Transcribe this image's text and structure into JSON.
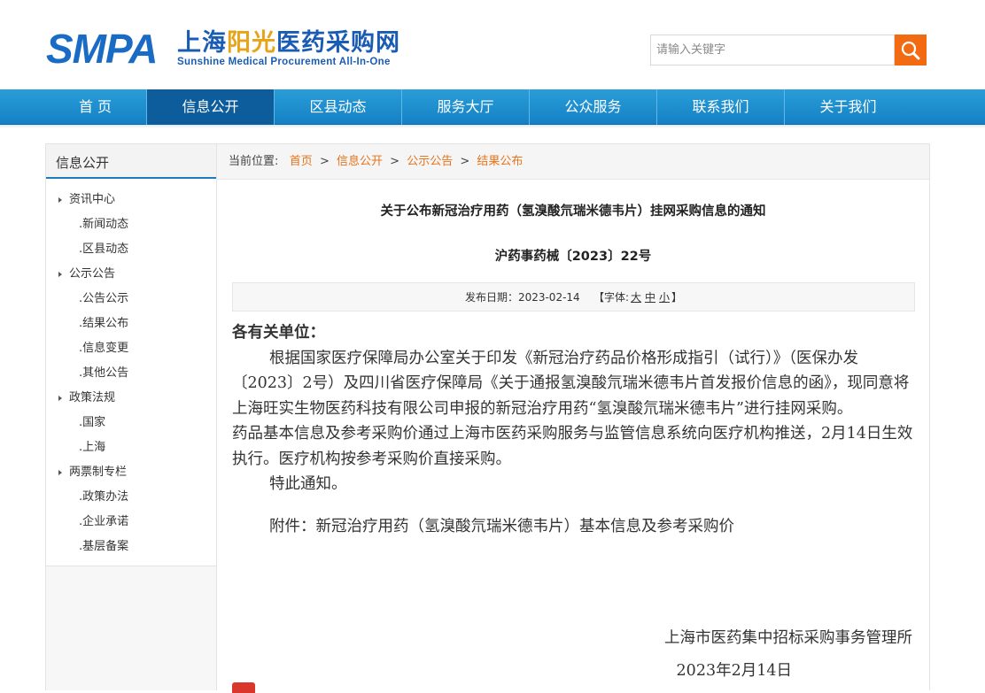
{
  "header": {
    "logo_abbr": "SMPA",
    "logo_cn_1": "上海",
    "logo_cn_2": "阳光",
    "logo_cn_3": "医药采购网",
    "logo_en": "Sunshine Medical Procurement All-In-One",
    "search_placeholder": "请输入关键字"
  },
  "nav": {
    "items": [
      {
        "label": "首 页"
      },
      {
        "label": "信息公开"
      },
      {
        "label": "区县动态"
      },
      {
        "label": "服务大厅"
      },
      {
        "label": "公众服务"
      },
      {
        "label": "联系我们"
      },
      {
        "label": "关于我们"
      }
    ],
    "active_index": 1
  },
  "sidebar": {
    "title": "信息公开",
    "items": [
      {
        "label": "资讯中心"
      },
      {
        "label": ".新闻动态"
      },
      {
        "label": ".区县动态"
      },
      {
        "label": "公示公告"
      },
      {
        "label": ".公告公示"
      },
      {
        "label": ".结果公布"
      },
      {
        "label": ".信息变更"
      },
      {
        "label": ".其他公告"
      },
      {
        "label": "政策法规"
      },
      {
        "label": ".国家"
      },
      {
        "label": ".上海"
      },
      {
        "label": "两票制专栏"
      },
      {
        "label": ".政策办法"
      },
      {
        "label": ".企业承诺"
      },
      {
        "label": ".基层备案"
      }
    ]
  },
  "breadcrumb": {
    "prefix": "当前位置:",
    "items": [
      "首页",
      "信息公开",
      "公示公告",
      "结果公布"
    ],
    "separator": ">"
  },
  "article": {
    "title": "关于公布新冠治疗用药（氢溴酸氘瑞米德韦片）挂网采购信息的通知",
    "doc_number": "沪药事药械〔2023〕22号",
    "publish_label": "发布日期：2023-02-14",
    "font_size_label": "【字体:",
    "font_large": "大",
    "font_medium": "中",
    "font_small": "小",
    "font_close": "】",
    "salutation": "各有关单位：",
    "para1": "根据国家医疗保障局办公室关于印发《新冠治疗药品价格形成指引（试行）》（医保办发〔2023〕2号）及四川省医疗保障局《关于通报氢溴酸氘瑞米德韦片首发报价信息的函》，现同意将上海旺实生物医药科技有限公司申报的新冠治疗用药“氢溴酸氘瑞米德韦片”进行挂网采购。",
    "para2": "药品基本信息及参考采购价通过上海市医药采购服务与监管信息系统向医疗机构推送，2月14日生效执行。医疗机构按参考采购价直接采购。",
    "para3": "特此通知。",
    "attachment": "附件：新冠治疗用药（氢溴酸氘瑞米德韦片）基本信息及参考采购价",
    "signer": "上海市医药集中招标采购事务管理所",
    "sign_date": "2023年2月14日"
  },
  "colors": {
    "nav_bg": "#1a8fd0",
    "nav_active": "#0d5d9c",
    "link_orange": "#e8731a",
    "search_btn": "#f26b13",
    "logo_blue": "#1a6bc4",
    "logo_gold": "#e8a419"
  }
}
